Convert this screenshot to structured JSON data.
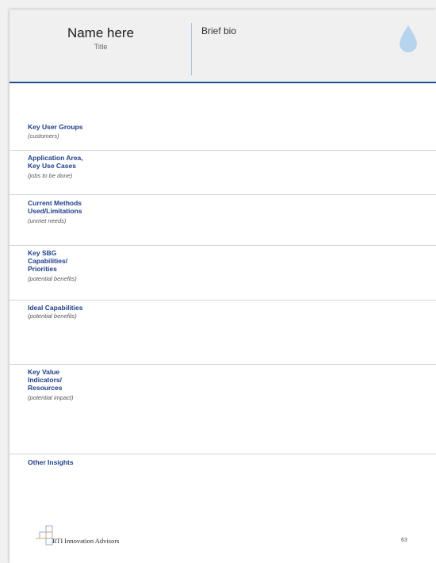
{
  "header": {
    "name": "Name here",
    "title": "Title",
    "bio_label": "Brief bio",
    "drop_icon": "water-drop-icon",
    "accent_color": "#1f4f8f",
    "drop_color": "#b7d4ee"
  },
  "sections": [
    {
      "label_lines": [
        "Key User Groups"
      ],
      "note": "(customers)"
    },
    {
      "label_lines": [
        "Application Area,",
        "Key Use Cases"
      ],
      "note": "(jobs to be done)"
    },
    {
      "label_lines": [
        "Current Methods",
        "Used/Limitations"
      ],
      "note": "(unmet needs)"
    },
    {
      "label_lines": [
        "Key SBG",
        "Capabilities/",
        "Priorities"
      ],
      "note": "(potential benefits)"
    },
    {
      "label_lines": [
        "Ideal Capabilities"
      ],
      "note": "(potential benefits)"
    },
    {
      "label_lines": [
        "Key Value",
        "Indicators/",
        "Resources"
      ],
      "note": "(potential impact)"
    },
    {
      "label_lines": [
        "Other Insights"
      ],
      "note": ""
    }
  ],
  "footer": {
    "logo_text": "RTI Innovation Advisors",
    "logo_icon": "rti-logo-icon",
    "page_number": "63"
  }
}
